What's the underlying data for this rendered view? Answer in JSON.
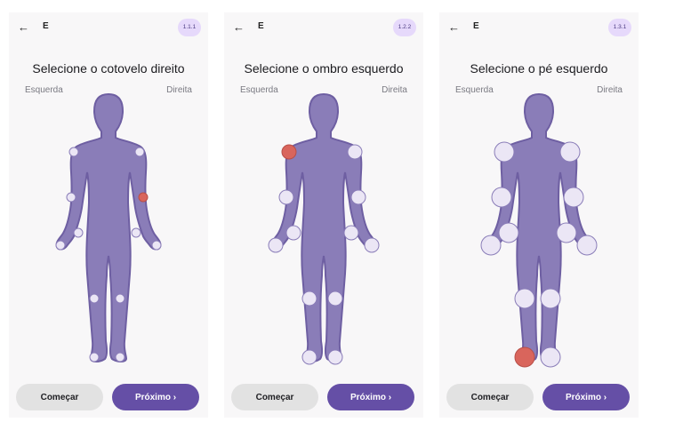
{
  "colors": {
    "body": "#8a7db8",
    "body_outline": "#6e5fa2",
    "point": "#ebe6f5",
    "point_stroke": "#8a7db8",
    "selected": "#d9655c",
    "accent": "#654fa6"
  },
  "screens": [
    {
      "back_icon": "arrow-left-icon",
      "letter": "E",
      "badge": "1.1.1",
      "title": "Selecione o cotovelo direito",
      "left_label": "Esquerda",
      "right_label": "Direita",
      "start_label": "Começar",
      "next_label": "Próximo ›",
      "selected": "right_elbow",
      "point_size": "small"
    },
    {
      "back_icon": "arrow-left-icon",
      "letter": "E",
      "badge": "1.2.2",
      "title": "Selecione o ombro esquerdo",
      "left_label": "Esquerda",
      "right_label": "Direita",
      "start_label": "Começar",
      "next_label": "Próximo ›",
      "selected": "left_shoulder",
      "point_size": "medium"
    },
    {
      "back_icon": "arrow-left-icon",
      "letter": "E",
      "badge": "1.3.1",
      "title": "Selecione o pé esquerdo",
      "left_label": "Esquerda",
      "right_label": "Direita",
      "start_label": "Começar",
      "next_label": "Próximo ›",
      "selected": "left_foot",
      "point_size": "large"
    }
  ]
}
